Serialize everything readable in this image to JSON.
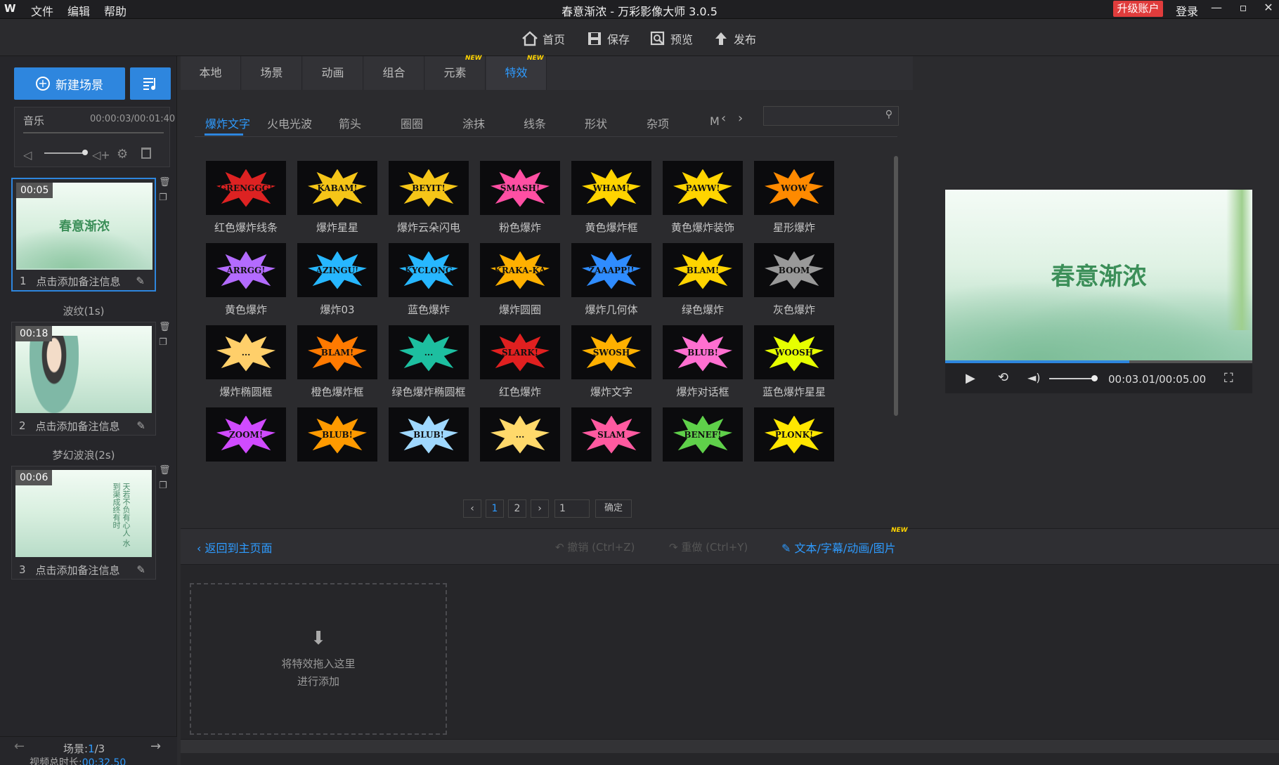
{
  "app": {
    "logo": "W",
    "title": "春意渐浓 - 万彩影像大师 3.0.5",
    "upgrade_label": "升级账户",
    "login_label": "登录"
  },
  "menu": [
    "文件",
    "编辑",
    "帮助"
  ],
  "toolbar": {
    "home": "首页",
    "save": "保存",
    "preview": "预览",
    "publish": "发布"
  },
  "left": {
    "new_scene": "新建场景",
    "music": {
      "label": "音乐",
      "time": "00:00:03/00:01:40"
    },
    "scenes": [
      {
        "duration": "00:05",
        "index": "1",
        "note": "点击添加备注信息",
        "thumb_text": "春意渐浓"
      },
      {
        "duration": "00:18",
        "index": "2",
        "note": "点击添加备注信息",
        "thumb_text": ""
      },
      {
        "duration": "00:06",
        "index": "3",
        "note": "点击添加备注信息",
        "thumb_text": "天若不负有心人 水到渠成终有时"
      }
    ],
    "transitions": [
      "波纹(1s)",
      "梦幻波浪(2s)"
    ],
    "footer": {
      "scene_label": "场景:",
      "scene_current": "1",
      "scene_total": "/3",
      "total_label": "视频总时长:",
      "total_value": "00:32.50"
    }
  },
  "tabs": [
    {
      "label": "本地",
      "new": false
    },
    {
      "label": "场景",
      "new": false
    },
    {
      "label": "动画",
      "new": false
    },
    {
      "label": "组合",
      "new": false
    },
    {
      "label": "元素",
      "new": true
    },
    {
      "label": "特效",
      "new": true
    }
  ],
  "new_tag": "NEW",
  "subtabs": [
    "爆炸文字",
    "火电光波",
    "箭头",
    "圈圈",
    "涂抹",
    "线条",
    "形状",
    "杂项",
    "M"
  ],
  "search": {
    "placeholder": ""
  },
  "effects": [
    {
      "label": "红色爆炸线条",
      "word": "GRENGGG!",
      "color": "#d22"
    },
    {
      "label": "爆炸星星",
      "word": "KABAM!",
      "color": "#f5c518"
    },
    {
      "label": "爆炸云朵闪电",
      "word": "BEYIT!",
      "color": "#f5c518"
    },
    {
      "label": "粉色爆炸",
      "word": "SMASH!",
      "color": "#ff4fa3"
    },
    {
      "label": "黄色爆炸框",
      "word": "WHAM!",
      "color": "#ffd400"
    },
    {
      "label": "黄色爆炸装饰",
      "word": "PAWW!",
      "color": "#ffd400"
    },
    {
      "label": "星形爆炸",
      "word": "WOW",
      "color": "#ff8a00"
    },
    {
      "label": "黄色爆炸",
      "word": "ARRGG!",
      "color": "#b36bff"
    },
    {
      "label": "爆炸03",
      "word": "AZINGU!",
      "color": "#27b7ff"
    },
    {
      "label": "蓝色爆炸",
      "word": "KYCLONG",
      "color": "#27b7ff"
    },
    {
      "label": "爆炸圆圈",
      "word": "KRAKA-KA",
      "color": "#ffb000"
    },
    {
      "label": "爆炸几何体",
      "word": "ZAAAPP!!",
      "color": "#2f8cff"
    },
    {
      "label": "绿色爆炸",
      "word": "BLAM!",
      "color": "#ffd400"
    },
    {
      "label": "灰色爆炸",
      "word": "BOOM",
      "color": "#999"
    },
    {
      "label": "爆炸椭圆框",
      "word": "...",
      "color": "#ffcf6a"
    },
    {
      "label": "橙色爆炸框",
      "word": "BLAM!",
      "color": "#ff7a00"
    },
    {
      "label": "绿色爆炸椭圆框",
      "word": "...",
      "color": "#1dbfa0"
    },
    {
      "label": "红色爆炸",
      "word": "SLARK!",
      "color": "#e02020"
    },
    {
      "label": "爆炸文字",
      "word": "SWOSH",
      "color": "#ffb000"
    },
    {
      "label": "爆炸对话框",
      "word": "BLUB!",
      "color": "#ff6fd0"
    },
    {
      "label": "蓝色爆炸星星",
      "word": "WOOSH",
      "color": "#e6ff00"
    },
    {
      "label": "",
      "word": "ZOOM!",
      "color": "#d04bff"
    },
    {
      "label": "",
      "word": "BLUB!",
      "color": "#ff9a00"
    },
    {
      "label": "",
      "word": "BLUB!",
      "color": "#9fd8ff"
    },
    {
      "label": "",
      "word": "...",
      "color": "#ffd96b"
    },
    {
      "label": "",
      "word": "SLAM",
      "color": "#ff5aa0"
    },
    {
      "label": "",
      "word": "BENEF!",
      "color": "#5fd04a"
    },
    {
      "label": "",
      "word": "PLONK!",
      "color": "#ffe600"
    }
  ],
  "pagination": {
    "pages": [
      "1",
      "2"
    ],
    "input": "1",
    "confirm": "确定"
  },
  "bottom": {
    "back": "返回到主页面",
    "undo": "撤销 (Ctrl+Z)",
    "redo": "重做 (Ctrl+Y)",
    "text_tool": "文本/字幕/动画/图片"
  },
  "dropzone": {
    "line1": "将特效拖入这里",
    "line2": "进行添加"
  },
  "preview": {
    "title": "春意渐浓",
    "time": "00:03.01/00:05.00",
    "progress": 0.6
  },
  "colors": {
    "accent": "#2e86de",
    "upgrade": "#e03c3c",
    "new_tag": "#ffd400"
  }
}
